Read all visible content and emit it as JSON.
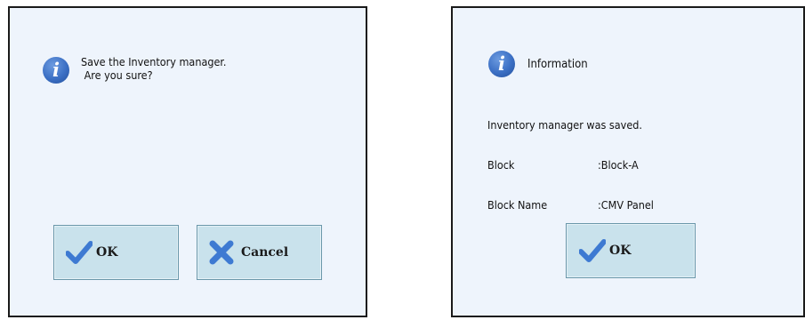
{
  "confirm_dialog": {
    "message_line1": "Save the Inventory manager.",
    "message_line2": " Are you sure?",
    "ok_label": "OK",
    "cancel_label": "Cancel"
  },
  "info_dialog": {
    "title": "Information",
    "message": "Inventory manager was saved.",
    "details": [
      {
        "label": "Block",
        "value": ":Block-A"
      },
      {
        "label": "Block Name",
        "value": ":CMV Panel"
      }
    ],
    "ok_label": "OK"
  },
  "colors": {
    "dialog_background": "#eef4fc",
    "button_background": "#c9e2ec",
    "info_icon": "#3b6fc4",
    "check_icon": "#3e7ad2",
    "cancel_x_icon": "#3e7ad2"
  },
  "icons": {
    "info": "info-icon",
    "ok": "checkmark-icon",
    "cancel": "x-icon"
  }
}
